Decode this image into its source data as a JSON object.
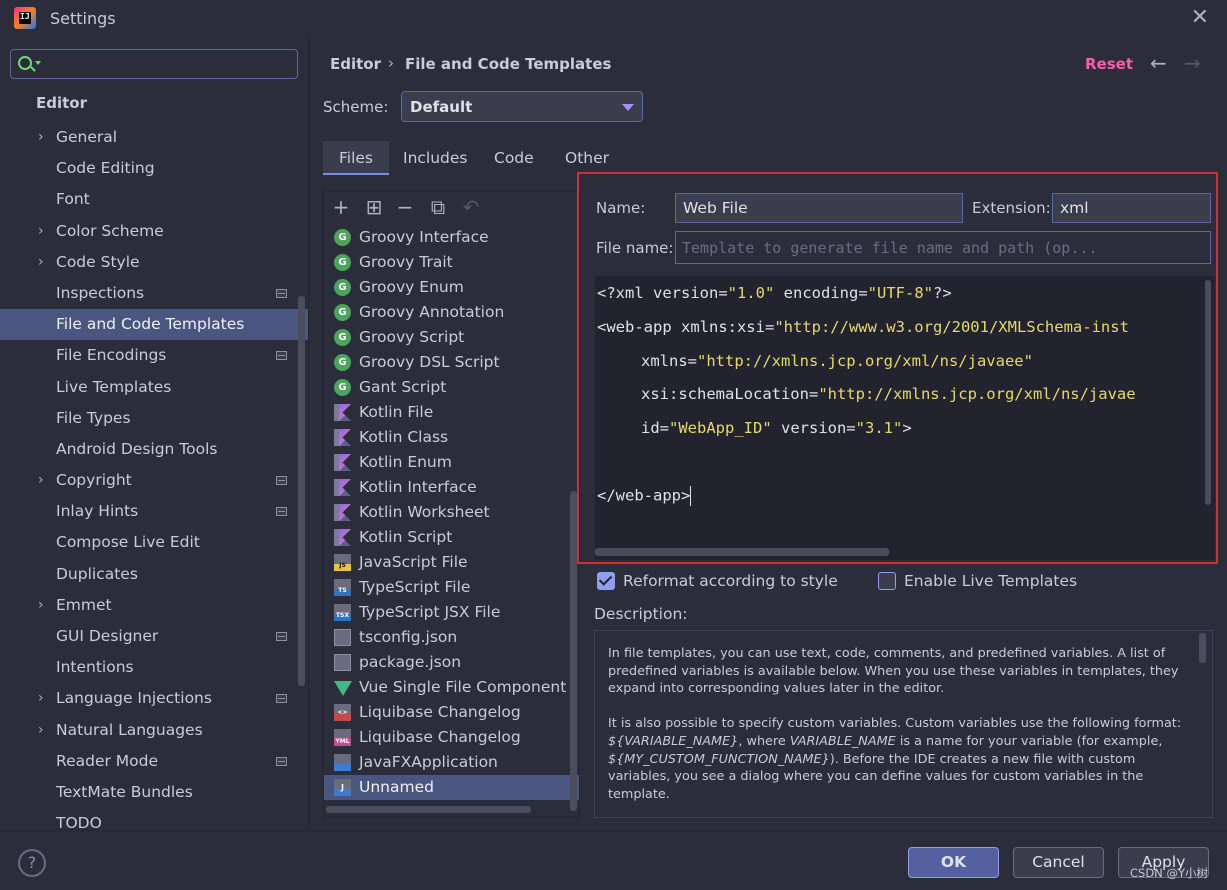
{
  "window": {
    "title": "Settings"
  },
  "search": {
    "placeholder": "",
    "value": ""
  },
  "sidebar": {
    "section_title": "Editor",
    "items": [
      {
        "label": "General",
        "expandable": true,
        "badge": false
      },
      {
        "label": "Code Editing",
        "expandable": false,
        "badge": false
      },
      {
        "label": "Font",
        "expandable": false,
        "badge": false
      },
      {
        "label": "Color Scheme",
        "expandable": true,
        "badge": false
      },
      {
        "label": "Code Style",
        "expandable": true,
        "badge": false
      },
      {
        "label": "Inspections",
        "expandable": false,
        "badge": true
      },
      {
        "label": "File and Code Templates",
        "expandable": false,
        "badge": false,
        "selected": true
      },
      {
        "label": "File Encodings",
        "expandable": false,
        "badge": true
      },
      {
        "label": "Live Templates",
        "expandable": false,
        "badge": false
      },
      {
        "label": "File Types",
        "expandable": false,
        "badge": false
      },
      {
        "label": "Android Design Tools",
        "expandable": false,
        "badge": false
      },
      {
        "label": "Copyright",
        "expandable": true,
        "badge": true
      },
      {
        "label": "Inlay Hints",
        "expandable": false,
        "badge": true
      },
      {
        "label": "Compose Live Edit",
        "expandable": false,
        "badge": false
      },
      {
        "label": "Duplicates",
        "expandable": false,
        "badge": false
      },
      {
        "label": "Emmet",
        "expandable": true,
        "badge": false
      },
      {
        "label": "GUI Designer",
        "expandable": false,
        "badge": true
      },
      {
        "label": "Intentions",
        "expandable": false,
        "badge": false
      },
      {
        "label": "Language Injections",
        "expandable": true,
        "badge": true
      },
      {
        "label": "Natural Languages",
        "expandable": true,
        "badge": false
      },
      {
        "label": "Reader Mode",
        "expandable": false,
        "badge": true
      },
      {
        "label": "TextMate Bundles",
        "expandable": false,
        "badge": false
      },
      {
        "label": "TODO",
        "expandable": false,
        "badge": false
      }
    ]
  },
  "header": {
    "breadcrumb_parent": "Editor",
    "breadcrumb_separator": "›",
    "breadcrumb_current": "File and Code Templates",
    "reset_label": "Reset",
    "back_icon": "←",
    "forward_icon": "→"
  },
  "scheme": {
    "label": "Scheme:",
    "value": "Default"
  },
  "tabs": [
    {
      "label": "Files",
      "active": true
    },
    {
      "label": "Includes",
      "active": false
    },
    {
      "label": "Code",
      "active": false
    },
    {
      "label": "Other",
      "active": false
    }
  ],
  "toolbar": {
    "add": "+",
    "remove": "−",
    "copy": "⧉",
    "reset": "↶",
    "add_child": "⊞"
  },
  "templates": [
    {
      "label": "Groovy Interface",
      "icon": "groovy",
      "glyph": "G"
    },
    {
      "label": "Groovy Trait",
      "icon": "groovy",
      "glyph": "G"
    },
    {
      "label": "Groovy Enum",
      "icon": "groovy",
      "glyph": "G"
    },
    {
      "label": "Groovy Annotation",
      "icon": "groovy",
      "glyph": "G"
    },
    {
      "label": "Groovy Script",
      "icon": "groovy",
      "glyph": "G"
    },
    {
      "label": "Groovy DSL Script",
      "icon": "groovy",
      "glyph": "G"
    },
    {
      "label": "Gant Script",
      "icon": "groovy",
      "glyph": "G"
    },
    {
      "label": "Kotlin File",
      "icon": "kotlin",
      "glyph": ""
    },
    {
      "label": "Kotlin Class",
      "icon": "kotlin",
      "glyph": ""
    },
    {
      "label": "Kotlin Enum",
      "icon": "kotlin",
      "glyph": ""
    },
    {
      "label": "Kotlin Interface",
      "icon": "kotlin",
      "glyph": ""
    },
    {
      "label": "Kotlin Worksheet",
      "icon": "kotlin",
      "glyph": ""
    },
    {
      "label": "Kotlin Script",
      "icon": "kotlin",
      "glyph": ""
    },
    {
      "label": "JavaScript File",
      "icon": "js",
      "glyph": "JS"
    },
    {
      "label": "TypeScript File",
      "icon": "ts",
      "glyph": "TS"
    },
    {
      "label": "TypeScript JSX File",
      "icon": "ts",
      "glyph": "TSX"
    },
    {
      "label": "tsconfig.json",
      "icon": "json",
      "glyph": ""
    },
    {
      "label": "package.json",
      "icon": "json",
      "glyph": ""
    },
    {
      "label": "Vue Single File Component",
      "icon": "vue",
      "glyph": ""
    },
    {
      "label": "Liquibase Changelog",
      "icon": "liqxml",
      "glyph": "<>"
    },
    {
      "label": "Liquibase Changelog",
      "icon": "liqyml",
      "glyph": "YML"
    },
    {
      "label": "JavaFXApplication",
      "icon": "javafx",
      "glyph": ""
    },
    {
      "label": "Unnamed",
      "icon": "unnamed",
      "glyph": "J",
      "selected": true
    }
  ],
  "form": {
    "name_label": "Name:",
    "name_value": "Web File",
    "extension_label": "Extension:",
    "extension_value": "xml",
    "filename_label": "File name:",
    "filename_placeholder": "Template to generate file name and path (op..."
  },
  "code": {
    "line1_a": "<?xml version=",
    "line1_b": "\"1.0\"",
    "line1_c": " encoding=",
    "line1_d": "\"UTF-8\"",
    "line1_e": "?>",
    "line2_a": "<web-app xmlns:xsi=",
    "line2_b": "\"http://www.w3.org/2001/XMLSchema-inst",
    "line3_a": "xmlns=",
    "line3_b": "\"http://xmlns.jcp.org/xml/ns/javaee\"",
    "line4_a": "xsi:schemaLocation=",
    "line4_b": "\"http://xmlns.jcp.org/xml/ns/javae",
    "line5_a": "id=",
    "line5_b": "\"WebApp_ID\"",
    "line5_c": " version=",
    "line5_d": "\"3.1\"",
    "line5_e": ">",
    "line7": "</web-app>"
  },
  "options": {
    "reformat_label": "Reformat according to style",
    "reformat_checked": true,
    "live_templates_label": "Enable Live Templates",
    "live_templates_checked": false
  },
  "description": {
    "label": "Description:",
    "p1": "In file templates, you can use text, code, comments, and predefined variables. A list of predefined variables is available below. When you use these variables in templates, they expand into corresponding values later in the editor.",
    "p2_a": "It is also possible to specify custom variables. Custom variables use the following format: ",
    "p2_var1": "${VARIABLE_NAME}",
    "p2_b": ", where ",
    "p2_var2": "VARIABLE_NAME",
    "p2_c": " is a name for your variable (for example, ",
    "p2_var3": "${MY_CUSTOM_FUNCTION_NAME}",
    "p2_d": "). Before the IDE creates a new file with custom variables, you see a dialog where you can define values for custom variables in the template."
  },
  "footer": {
    "help_label": "?",
    "ok_label": "OK",
    "cancel_label": "Cancel",
    "apply_label": "Apply",
    "watermark": "CSDN @Y小树"
  },
  "colors": {
    "accent": "#8e9ff0",
    "reset": "#ff5bab",
    "selection": "#4a5680",
    "highlight_border": "#d32f2f",
    "string": "#e6d96a"
  }
}
